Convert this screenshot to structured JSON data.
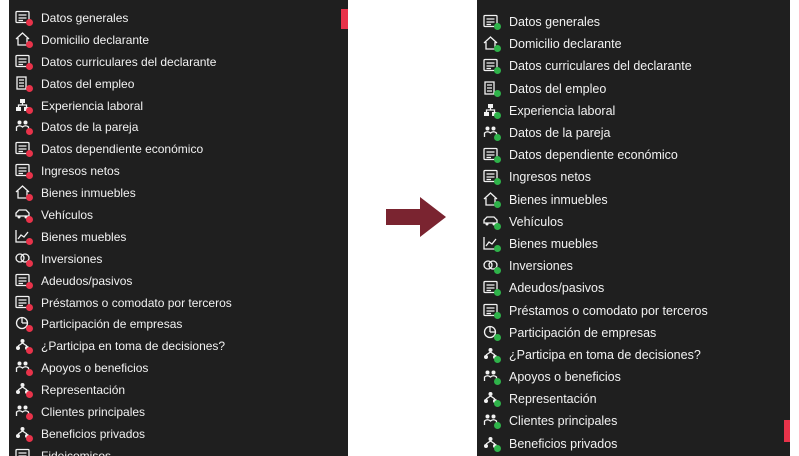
{
  "colors": {
    "panel_bg": "#1f1f1f",
    "text": "#f2f2f2",
    "status_incomplete": "#e8334a",
    "status_complete": "#2fb34a",
    "arrow": "#7a2430"
  },
  "left_menu": {
    "items": [
      {
        "label": "Datos generales",
        "icon": "id-card-icon",
        "status": "incomplete"
      },
      {
        "label": "Domicilio declarante",
        "icon": "home-icon",
        "status": "incomplete"
      },
      {
        "label": "Datos curriculares del declarante",
        "icon": "document-icon",
        "status": "incomplete"
      },
      {
        "label": "Datos del empleo",
        "icon": "building-icon",
        "status": "incomplete"
      },
      {
        "label": "Experiencia laboral",
        "icon": "org-chart-icon",
        "status": "incomplete"
      },
      {
        "label": "Datos de la pareja",
        "icon": "couple-icon",
        "status": "incomplete"
      },
      {
        "label": "Datos dependiente económico",
        "icon": "form-icon",
        "status": "incomplete"
      },
      {
        "label": "Ingresos netos",
        "icon": "money-icon",
        "status": "incomplete"
      },
      {
        "label": "Bienes inmuebles",
        "icon": "house-icon",
        "status": "incomplete"
      },
      {
        "label": "Vehículos",
        "icon": "car-icon",
        "status": "incomplete"
      },
      {
        "label": "Bienes muebles",
        "icon": "chart-icon",
        "status": "incomplete"
      },
      {
        "label": "Inversiones",
        "icon": "coins-icon",
        "status": "incomplete"
      },
      {
        "label": "Adeudos/pasivos",
        "icon": "wallet-icon",
        "status": "incomplete"
      },
      {
        "label": "Préstamos o comodato por terceros",
        "icon": "handshake-house-icon",
        "status": "incomplete"
      },
      {
        "label": "Participación de empresas",
        "icon": "pie-icon",
        "status": "incomplete"
      },
      {
        "label": "¿Participa en toma de decisiones?",
        "icon": "people-network-icon",
        "status": "incomplete"
      },
      {
        "label": "Apoyos o beneficios",
        "icon": "support-icon",
        "status": "incomplete"
      },
      {
        "label": "Representación",
        "icon": "group-icon",
        "status": "incomplete"
      },
      {
        "label": "Clientes principales",
        "icon": "clients-icon",
        "status": "incomplete"
      },
      {
        "label": "Beneficios privados",
        "icon": "person-group-icon",
        "status": "incomplete"
      },
      {
        "label": "Fideicomisos",
        "icon": "ledger-icon",
        "status": "incomplete"
      }
    ]
  },
  "right_menu": {
    "items": [
      {
        "label": "Datos generales",
        "icon": "id-card-icon",
        "status": "complete"
      },
      {
        "label": "Domicilio declarante",
        "icon": "home-icon",
        "status": "complete"
      },
      {
        "label": "Datos curriculares del declarante",
        "icon": "document-icon",
        "status": "complete"
      },
      {
        "label": "Datos del empleo",
        "icon": "building-icon",
        "status": "complete"
      },
      {
        "label": "Experiencia laboral",
        "icon": "org-chart-icon",
        "status": "complete"
      },
      {
        "label": "Datos de la pareja",
        "icon": "couple-icon",
        "status": "complete"
      },
      {
        "label": "Datos dependiente económico",
        "icon": "form-icon",
        "status": "complete"
      },
      {
        "label": "Ingresos netos",
        "icon": "money-icon",
        "status": "complete"
      },
      {
        "label": "Bienes inmuebles",
        "icon": "house-icon",
        "status": "complete"
      },
      {
        "label": "Vehículos",
        "icon": "car-icon",
        "status": "complete"
      },
      {
        "label": "Bienes muebles",
        "icon": "chart-icon",
        "status": "complete"
      },
      {
        "label": "Inversiones",
        "icon": "coins-icon",
        "status": "complete"
      },
      {
        "label": "Adeudos/pasivos",
        "icon": "wallet-icon",
        "status": "complete"
      },
      {
        "label": "Préstamos o comodato por terceros",
        "icon": "handshake-house-icon",
        "status": "complete"
      },
      {
        "label": "Participación de empresas",
        "icon": "pie-icon",
        "status": "complete"
      },
      {
        "label": "¿Participa en toma de decisiones?",
        "icon": "people-network-icon",
        "status": "complete"
      },
      {
        "label": "Apoyos o beneficios",
        "icon": "support-icon",
        "status": "complete"
      },
      {
        "label": "Representación",
        "icon": "group-icon",
        "status": "complete"
      },
      {
        "label": "Clientes principales",
        "icon": "clients-icon",
        "status": "complete"
      },
      {
        "label": "Beneficios privados",
        "icon": "person-group-icon",
        "status": "complete"
      }
    ]
  }
}
